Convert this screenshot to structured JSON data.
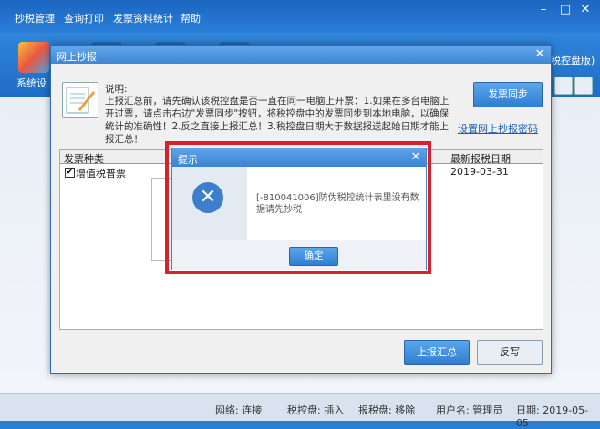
{
  "menu": {
    "items": [
      "抄税管理",
      "查询打印",
      "发票资料统计",
      "帮助"
    ]
  },
  "toolbar": {
    "system_label": "系统设",
    "right_label": "税控盘版)"
  },
  "dialog": {
    "title": "网上抄报",
    "note_heading": "说明:",
    "note_body": "上报汇总前，请先确认该税控盘是否一直在同一电脑上开票：1.如果在多台电脑上开过票，请点击右边\"发票同步\"按钮，将税控盘中的发票同步到本地电脑，以确保统计的准确性！2.反之直接上报汇总！3.税控盘日期大于数据报送起始日期才能上报汇总！",
    "sync_button": "发票同步",
    "password_link": "设置网上抄报密码",
    "columns": {
      "type": "发票种类",
      "date": "最新报税日期"
    },
    "rows": [
      {
        "checked": true,
        "type": "增值税普票",
        "date": "2019-03-31"
      }
    ],
    "upload_button": "上报汇总",
    "reverse_button": "反写"
  },
  "alert": {
    "title": "提示",
    "message": "[-810041006]防伪税控统计表里没有数据请先抄税",
    "ok_button": "确定"
  },
  "status": {
    "network": "网络: 连接",
    "tax_disk": "税控盘: 插入",
    "report_disk": "报税盘: 移除",
    "user": "用户名: 管理员",
    "date": "日期: 2019-05-05"
  },
  "colors": {
    "accent": "#2f7fd2",
    "highlight_frame": "#d8222a"
  },
  "icons": {
    "error": "x-circle-icon",
    "note": "notepad-icon"
  }
}
